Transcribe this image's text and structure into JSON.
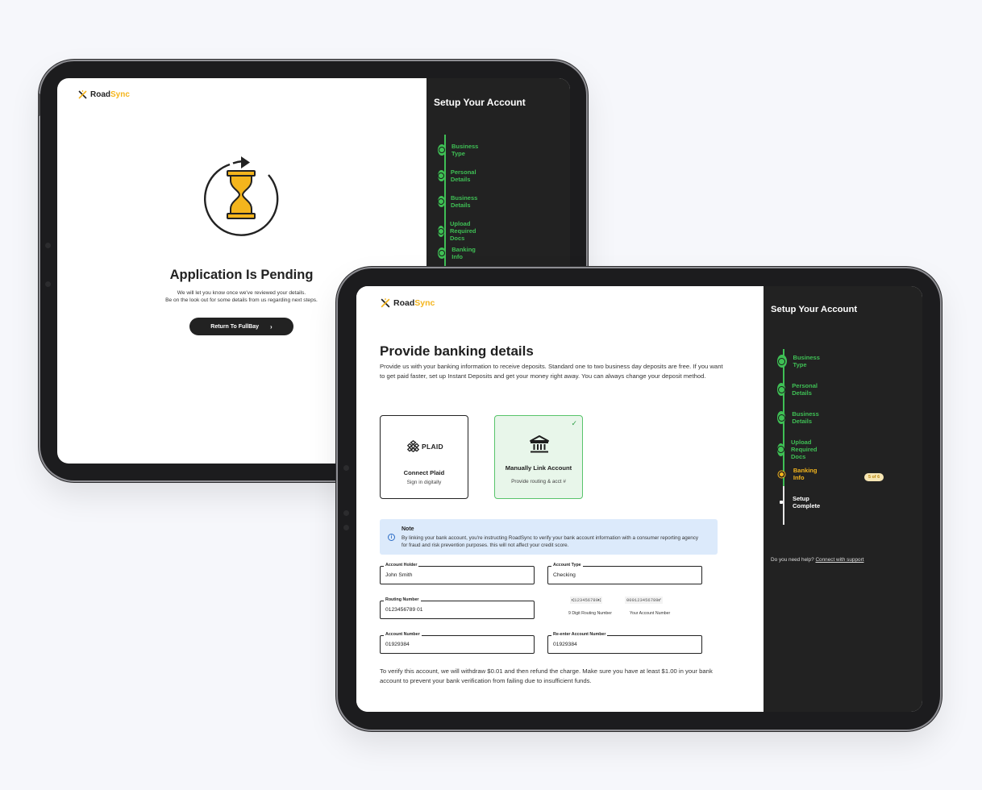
{
  "brand": {
    "name_part1": "Road",
    "name_part2": "Sync",
    "accent": "#f4b51d",
    "success": "#3fbf55"
  },
  "back_screen": {
    "sidebar_title": "Setup Your Account",
    "steps": [
      {
        "label": "Business Type",
        "status": "complete"
      },
      {
        "label": "Personal Details",
        "status": "complete"
      },
      {
        "label": "Business Details",
        "status": "complete"
      },
      {
        "label": "Upload Required Docs",
        "status": "complete"
      },
      {
        "label": "Banking Info",
        "status": "complete"
      }
    ],
    "icon": "hourglass-refresh-icon",
    "title": "Application Is Pending",
    "subtitle_line1": "We will let you know once we've reviewed your details.",
    "subtitle_line2": "Be on the look out for some details from us regarding next steps.",
    "return_button": "Return To FullBay"
  },
  "front_screen": {
    "title": "Provide banking details",
    "intro": "Provide us with your banking information to receive deposits. Standard one to two business day deposits are free. If you want to get paid faster, set up Instant Deposits and get your money right away. You can always change your deposit method.",
    "cards": {
      "plaid": {
        "logo": "PLAID",
        "title": "Connect Plaid",
        "subtitle": "Sign in digitally"
      },
      "manual": {
        "title": "Manually Link Account",
        "subtitle": "Provide routing & acct #",
        "selected": true
      }
    },
    "note": {
      "title": "Note",
      "body": "By linking your bank account, you're instructing RoadSync to verify your bank account information with a consumer reporting agency for fraud and risk prevention purposes. this will not affect your credit score."
    },
    "fields": {
      "account_holder": {
        "label": "Account Holder",
        "value": "John Smith"
      },
      "account_type": {
        "label": "Account Type",
        "value": "Checking"
      },
      "routing_number": {
        "label": "Routing Number",
        "value": "0123456789 01"
      },
      "account_number": {
        "label": "Account Number",
        "value": "01929384"
      },
      "reenter_account_number": {
        "label": "Re-enter Account Number",
        "value": "01929384"
      }
    },
    "check_image": {
      "routing_sample": "⑆123456789⑆",
      "account_sample": "000123456789⑈",
      "routing_caption": "9 Digit Routing Number",
      "account_caption": "Your Account Number"
    },
    "footer_note": "To verify this account, we will withdraw $0.01 and then refund the charge. Make sure you have at least $1.00 in your bank account to prevent your bank verification from failing due to insufficient funds.",
    "sidebar": {
      "title": "Setup Your Account",
      "steps": [
        {
          "label": "Business Type",
          "status": "complete"
        },
        {
          "label": "Personal Details",
          "status": "complete"
        },
        {
          "label": "Business Details",
          "status": "complete"
        },
        {
          "label": "Upload Required Docs",
          "status": "complete"
        },
        {
          "label": "Banking Info",
          "status": "active"
        },
        {
          "label": "Setup Complete",
          "status": "pending"
        }
      ],
      "step_badge": "5 of 6",
      "help_text": "Do you need help?",
      "help_link": "Connect with support"
    }
  }
}
